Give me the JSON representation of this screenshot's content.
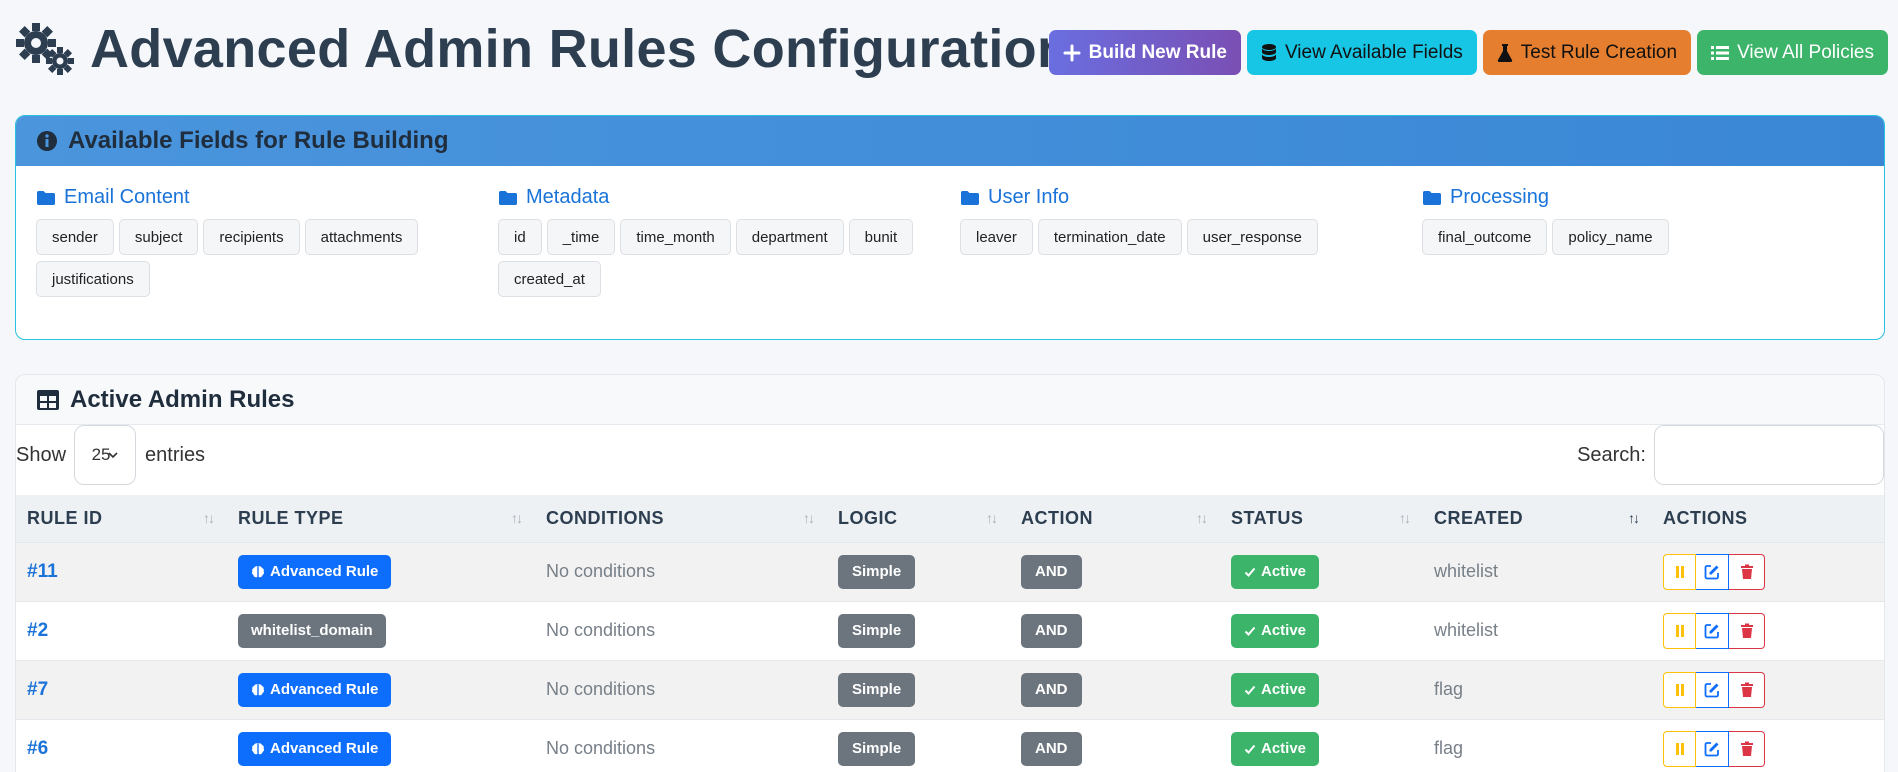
{
  "header": {
    "title": "Advanced Admin Rules Configuration",
    "buttons": {
      "build": "Build New Rule",
      "fields": "View Available Fields",
      "test": "Test Rule Creation",
      "policies": "View All Policies"
    }
  },
  "fields_panel": {
    "title": "Available Fields for Rule Building",
    "groups": [
      {
        "title": "Email Content",
        "fields": [
          "sender",
          "subject",
          "recipients",
          "attachments",
          "justifications"
        ]
      },
      {
        "title": "Metadata",
        "fields": [
          "id",
          "_time",
          "time_month",
          "department",
          "bunit",
          "created_at"
        ]
      },
      {
        "title": "User Info",
        "fields": [
          "leaver",
          "termination_date",
          "user_response"
        ]
      },
      {
        "title": "Processing",
        "fields": [
          "final_outcome",
          "policy_name"
        ]
      }
    ]
  },
  "rules_panel": {
    "title": "Active Admin Rules",
    "show_label": "Show",
    "entries_value": "25",
    "entries_label": "entries",
    "search_label": "Search:",
    "search_value": "",
    "columns": [
      "RULE ID",
      "RULE TYPE",
      "CONDITIONS",
      "LOGIC",
      "ACTION",
      "STATUS",
      "CREATED",
      "ACTIONS"
    ],
    "rows": [
      {
        "id": "#11",
        "type": "Advanced Rule",
        "type_style": "advanced",
        "conditions": "No conditions",
        "logic": "Simple",
        "action": "AND",
        "status": "Active",
        "created": "whitelist"
      },
      {
        "id": "#2",
        "type": "whitelist_domain",
        "type_style": "plain",
        "conditions": "No conditions",
        "logic": "Simple",
        "action": "AND",
        "status": "Active",
        "created": "whitelist"
      },
      {
        "id": "#7",
        "type": "Advanced Rule",
        "type_style": "advanced",
        "conditions": "No conditions",
        "logic": "Simple",
        "action": "AND",
        "status": "Active",
        "created": "flag"
      },
      {
        "id": "#6",
        "type": "Advanced Rule",
        "type_style": "advanced",
        "conditions": "No conditions",
        "logic": "Simple",
        "action": "AND",
        "status": "Active",
        "created": "flag"
      }
    ]
  },
  "colors": {
    "accent": "#1a73d9",
    "badge_primary": "#0d6efd",
    "badge_secondary": "#6c757d",
    "success": "#3cb46a",
    "warning": "#ffc107",
    "danger": "#dc3545"
  },
  "icons": {
    "title": "gears-icon",
    "build": "plus-icon",
    "fields": "database-icon",
    "test": "flask-icon",
    "policies": "list-icon",
    "fields_panel": "info-circle-icon",
    "group": "folder-icon",
    "rules_panel": "table-icon",
    "advanced": "brain-icon",
    "status": "check-icon",
    "row_actions": [
      "pause-icon",
      "edit-icon",
      "trash-icon"
    ]
  }
}
